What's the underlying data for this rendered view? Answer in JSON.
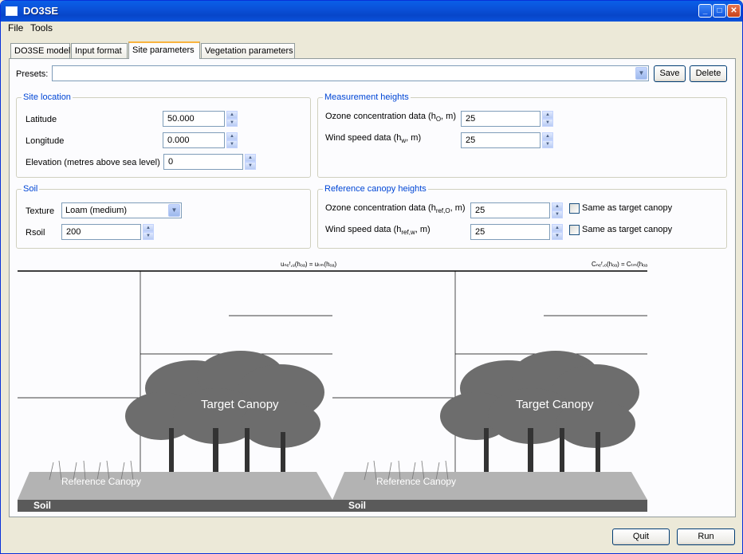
{
  "window": {
    "title": "DO3SE"
  },
  "menu": [
    "File",
    "Tools"
  ],
  "tabs": [
    "DO3SE model",
    "Input format",
    "Site parameters",
    "Vegetation parameters"
  ],
  "presets": {
    "label": "Presets:",
    "value": "",
    "save": "Save",
    "delete": "Delete"
  },
  "site_location": {
    "title": "Site location",
    "latitude_label": "Latitude",
    "latitude": "50.000",
    "longitude_label": "Longitude",
    "longitude": "0.000",
    "elevation_label": "Elevation (metres above sea level)",
    "elevation": "0"
  },
  "measurement_heights": {
    "title": "Measurement heights",
    "ozone_label": "Ozone concentration data (h",
    "ozone_sub": "O",
    "ozone_tail": ", m)",
    "ozone": "25",
    "wind_label": "Wind speed data (h",
    "wind_sub": "w",
    "wind_tail": ", m)",
    "wind": "25"
  },
  "soil": {
    "title": "Soil",
    "texture_label": "Texture",
    "texture": "Loam (medium)",
    "rsoil_label": "Rsoil",
    "rsoil": "200"
  },
  "reference_canopy": {
    "title": "Reference canopy heights",
    "ozone_label": "Ozone concentration data (h",
    "ozone_sub": "ref,O",
    "ozone_tail": ", m)",
    "ozone": "25",
    "wind_label": "Wind speed data (h",
    "wind_sub": "ref,w",
    "wind_tail": ", m)",
    "wind": "25",
    "same_label": "Same as target canopy"
  },
  "diagram": {
    "left_top": "uₙₑᶠ,ᵤ(hₒₐ) = uₜₘ(hₒₐ)",
    "right_top": "Cₙₑᶠ,ₒ(hₒₐ) = Cₜₘ(hₒₐ)",
    "target_canopy": "Target Canopy",
    "reference_canopy": "Reference Canopy",
    "soil": "Soil"
  },
  "footer": {
    "quit": "Quit",
    "run": "Run"
  }
}
